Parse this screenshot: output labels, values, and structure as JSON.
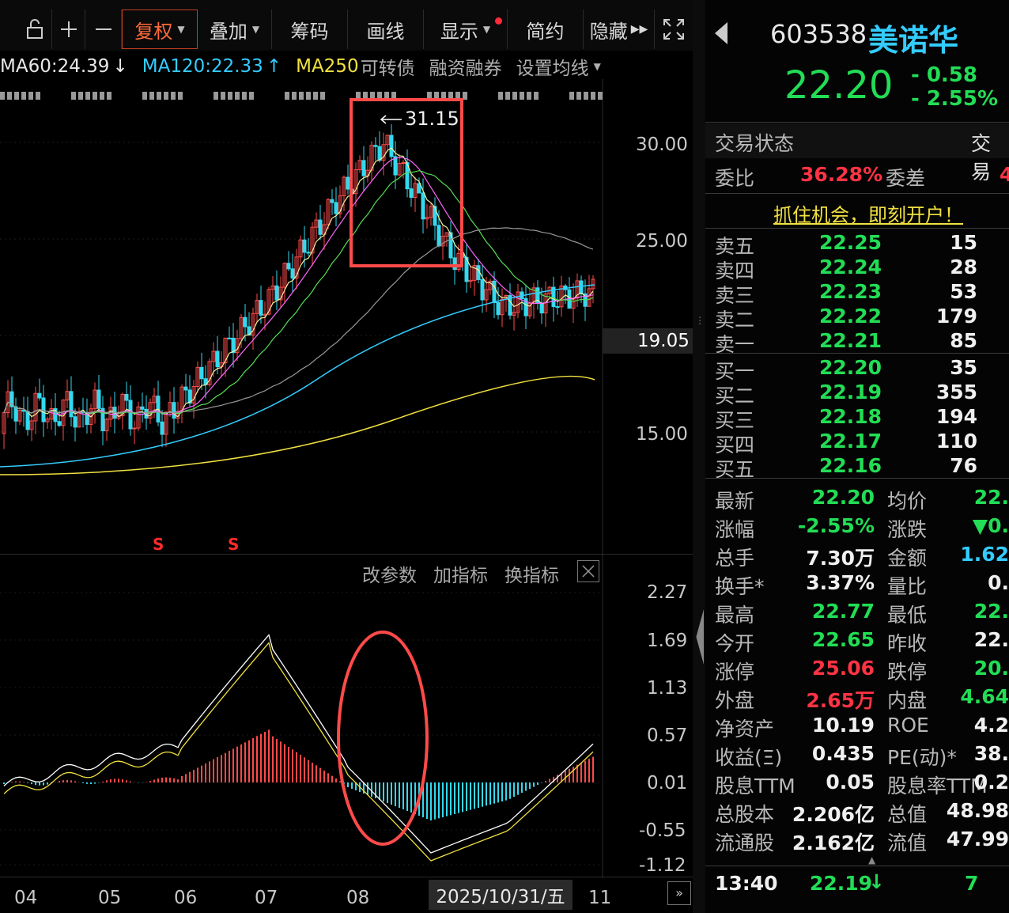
{
  "toolbar": {
    "buttons": [
      "复权",
      "叠加",
      "筹码",
      "画线",
      "显示",
      "简约",
      "隐藏"
    ],
    "icons": [
      "lock-icon",
      "plus-icon",
      "minus-icon",
      "expand-icon"
    ]
  },
  "ma_legend": {
    "ma60": "MA60:24.39",
    "ma120": "MA120:22.33",
    "ma250": "MA250",
    "links": [
      "可转债",
      "融资融券",
      "设置均线"
    ],
    "colors": {
      "ma60": "#e8e8e8",
      "ma120": "#33ccff",
      "ma250": "#f0e040"
    }
  },
  "main_chart": {
    "price_axis": [
      "30.00",
      "25.00",
      "19.05",
      "15.00"
    ],
    "peak_label": "31.15",
    "signal_marks": [
      "S",
      "S"
    ]
  },
  "indicator_toolbar": [
    "改参数",
    "加指标",
    "换指标"
  ],
  "macd_axis": [
    "2.27",
    "1.69",
    "1.13",
    "0.57",
    "0.01",
    "-0.55",
    "-1.12"
  ],
  "time_axis": [
    "04",
    "05",
    "06",
    "07",
    "08",
    "11"
  ],
  "date_highlight": "2025/10/31/五",
  "quote": {
    "code": "603538",
    "name": "美诺华",
    "price": "22.20",
    "change": "- 0.58",
    "change_pct": "- 2.55%"
  },
  "status": {
    "trade_status_label": "交易状态",
    "trade_status_value": "交易",
    "weibi_label": "委比",
    "weibi_value": "36.28%",
    "weicha_label": "委差",
    "weicha_value": "4"
  },
  "ad_text": "抓住机会，即刻开户！",
  "sell": [
    {
      "label": "卖五",
      "price": "22.25",
      "vol": "15"
    },
    {
      "label": "卖四",
      "price": "22.24",
      "vol": "28"
    },
    {
      "label": "卖三",
      "price": "22.23",
      "vol": "53"
    },
    {
      "label": "卖二",
      "price": "22.22",
      "vol": "179"
    },
    {
      "label": "卖一",
      "price": "22.21",
      "vol": "85"
    }
  ],
  "buy": [
    {
      "label": "买一",
      "price": "22.20",
      "vol": "35"
    },
    {
      "label": "买二",
      "price": "22.19",
      "vol": "355"
    },
    {
      "label": "买三",
      "price": "22.18",
      "vol": "194"
    },
    {
      "label": "买四",
      "price": "22.17",
      "vol": "110"
    },
    {
      "label": "买五",
      "price": "22.16",
      "vol": "76"
    }
  ],
  "stats": [
    {
      "l1": "最新",
      "v1": "22.20",
      "c1": "green",
      "l2": "均价",
      "v2": "22.",
      "c2": "green"
    },
    {
      "l1": "涨幅",
      "v1": "-2.55%",
      "c1": "green",
      "l2": "涨跌",
      "v2": "▼0.",
      "c2": "green"
    },
    {
      "l1": "总手",
      "v1": "7.30万",
      "c1": "white",
      "l2": "金额",
      "v2": "1.62",
      "c2": "cyan"
    },
    {
      "l1": "换手*",
      "v1": "3.37%",
      "c1": "white",
      "l2": "量比",
      "v2": "0.",
      "c2": "white"
    },
    {
      "l1": "最高",
      "v1": "22.77",
      "c1": "green",
      "l2": "最低",
      "v2": "22.",
      "c2": "green"
    },
    {
      "l1": "今开",
      "v1": "22.65",
      "c1": "green",
      "l2": "昨收",
      "v2": "22.",
      "c2": "white"
    },
    {
      "l1": "涨停",
      "v1": "25.06",
      "c1": "red",
      "l2": "跌停",
      "v2": "20.",
      "c2": "green"
    },
    {
      "l1": "外盘",
      "v1": "2.65万",
      "c1": "red",
      "l2": "内盘",
      "v2": "4.64",
      "c2": "green"
    },
    {
      "l1": "净资产",
      "v1": "10.19",
      "c1": "white",
      "l2": "ROE",
      "v2": "4.2",
      "c2": "white"
    },
    {
      "l1": "收益(Ξ)",
      "v1": "0.435",
      "c1": "white",
      "l2": "PE(动)*",
      "v2": "38.",
      "c2": "white"
    },
    {
      "l1": "股息TTM",
      "v1": "0.05",
      "c1": "white",
      "l2": "股息率TTM",
      "v2": "0.2",
      "c2": "white"
    },
    {
      "l1": "总股本",
      "v1": "2.206亿",
      "c1": "white",
      "l2": "总值",
      "v2": "48.98",
      "c2": "white"
    },
    {
      "l1": "流通股",
      "v1": "2.162亿",
      "c1": "white",
      "l2": "流值",
      "v2": "47.99",
      "c2": "white"
    }
  ],
  "tick": {
    "time": "13:40",
    "price": "22.19",
    "vol": "7"
  }
}
